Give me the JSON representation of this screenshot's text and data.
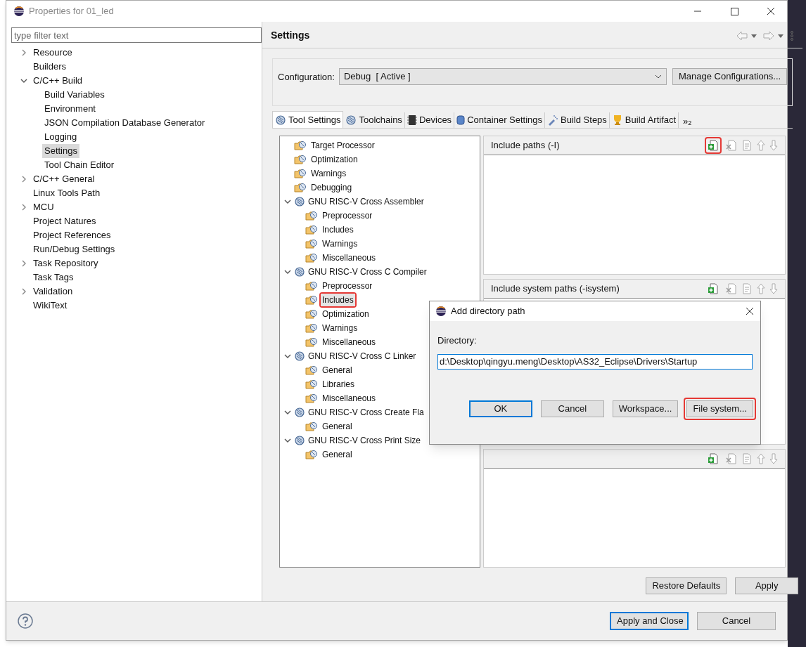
{
  "window": {
    "title": "Properties for 01_led"
  },
  "filter": {
    "placeholder": "type filter text"
  },
  "nav": [
    {
      "label": "Resource",
      "expanded": false,
      "selected": false
    },
    {
      "label": "Builders",
      "selected": false
    },
    {
      "label": "C/C++ Build",
      "expanded": true,
      "selected": false,
      "children": [
        {
          "label": "Build Variables",
          "selected": false
        },
        {
          "label": "Environment",
          "selected": false
        },
        {
          "label": "JSON Compilation Database Generator",
          "selected": false
        },
        {
          "label": "Logging",
          "selected": false
        },
        {
          "label": "Settings",
          "selected": true
        },
        {
          "label": "Tool Chain Editor",
          "selected": false
        }
      ]
    },
    {
      "label": "C/C++ General",
      "expanded": false,
      "selected": false
    },
    {
      "label": "Linux Tools Path",
      "selected": false
    },
    {
      "label": "MCU",
      "expanded": false,
      "selected": false
    },
    {
      "label": "Project Natures",
      "selected": false
    },
    {
      "label": "Project References",
      "selected": false
    },
    {
      "label": "Run/Debug Settings",
      "selected": false
    },
    {
      "label": "Task Repository",
      "expanded": false,
      "selected": false
    },
    {
      "label": "Task Tags",
      "selected": false
    },
    {
      "label": "Validation",
      "expanded": false,
      "selected": false
    },
    {
      "label": "WikiText",
      "selected": false
    }
  ],
  "page_title": "Settings",
  "configuration": {
    "label": "Configuration:",
    "value": "Debug  [ Active ]",
    "button": "Manage Configurations..."
  },
  "tabs": [
    {
      "label": "Tool Settings",
      "kind": "gear",
      "selected": true
    },
    {
      "label": "Toolchains",
      "kind": "gear",
      "selected": false
    },
    {
      "label": "Devices",
      "kind": "chip",
      "selected": false
    },
    {
      "label": "Container Settings",
      "kind": "container",
      "selected": false
    },
    {
      "label": "Build Steps",
      "kind": "spray",
      "selected": false
    },
    {
      "label": "Build Artifact",
      "kind": "trophy",
      "selected": false
    }
  ],
  "tabs_overflow": "»",
  "tabs_overflow_count": "2",
  "tool_tree": [
    {
      "label": "Target Processor",
      "kind": "folder",
      "highlighted": false
    },
    {
      "label": "Optimization",
      "kind": "folder",
      "highlighted": false
    },
    {
      "label": "Warnings",
      "kind": "folder",
      "highlighted": false
    },
    {
      "label": "Debugging",
      "kind": "folder",
      "highlighted": false
    },
    {
      "label": "GNU RISC-V Cross Assembler",
      "kind": "tool",
      "expanded": true,
      "children": [
        {
          "label": "Preprocessor",
          "kind": "folder",
          "highlighted": false
        },
        {
          "label": "Includes",
          "kind": "folder",
          "highlighted": false
        },
        {
          "label": "Warnings",
          "kind": "folder",
          "highlighted": false
        },
        {
          "label": "Miscellaneous",
          "kind": "folder",
          "highlighted": false
        }
      ]
    },
    {
      "label": "GNU RISC-V Cross C Compiler",
      "kind": "tool",
      "expanded": true,
      "children": [
        {
          "label": "Preprocessor",
          "kind": "folder",
          "highlighted": false
        },
        {
          "label": "Includes",
          "kind": "folder",
          "highlighted": true
        },
        {
          "label": "Optimization",
          "kind": "folder",
          "highlighted": false
        },
        {
          "label": "Warnings",
          "kind": "folder",
          "highlighted": false
        },
        {
          "label": "Miscellaneous",
          "kind": "folder",
          "highlighted": false
        }
      ]
    },
    {
      "label": "GNU RISC-V Cross C Linker",
      "kind": "tool",
      "expanded": true,
      "children": [
        {
          "label": "General",
          "kind": "folder",
          "highlighted": false
        },
        {
          "label": "Libraries",
          "kind": "folder",
          "highlighted": false
        },
        {
          "label": "Miscellaneous",
          "kind": "folder",
          "highlighted": false
        }
      ]
    },
    {
      "label": "GNU RISC-V Cross Create Fla",
      "kind": "tool",
      "expanded": true,
      "children": [
        {
          "label": "General",
          "kind": "folder",
          "highlighted": false
        }
      ]
    },
    {
      "label": "GNU RISC-V Cross Print Size",
      "kind": "tool",
      "expanded": true,
      "children": [
        {
          "label": "General",
          "kind": "folder",
          "highlighted": false
        }
      ]
    }
  ],
  "path_lists": [
    {
      "title": "Include paths (-I)",
      "add_highlighted": true
    },
    {
      "title": "Include system paths (-isystem)",
      "add_highlighted": false
    },
    {
      "add_highlighted": false
    }
  ],
  "page_buttons": [
    "Restore Defaults",
    "Apply"
  ],
  "dialog_buttons": [
    {
      "label": "Apply and Close",
      "default": true
    },
    {
      "label": "Cancel",
      "default": false
    }
  ],
  "popup": {
    "title": "Add directory path",
    "label": "Directory:",
    "value": "d:\\Desktop\\qingyu.meng\\Desktop\\AS32_Eclipse\\Drivers\\Startup",
    "buttons": [
      {
        "label": "OK",
        "default": true,
        "highlighted": false
      },
      {
        "label": "Cancel",
        "default": false,
        "highlighted": false
      },
      {
        "label": "Workspace...",
        "default": false,
        "highlighted": false
      },
      {
        "label": "File system...",
        "default": false,
        "highlighted": true
      }
    ]
  }
}
